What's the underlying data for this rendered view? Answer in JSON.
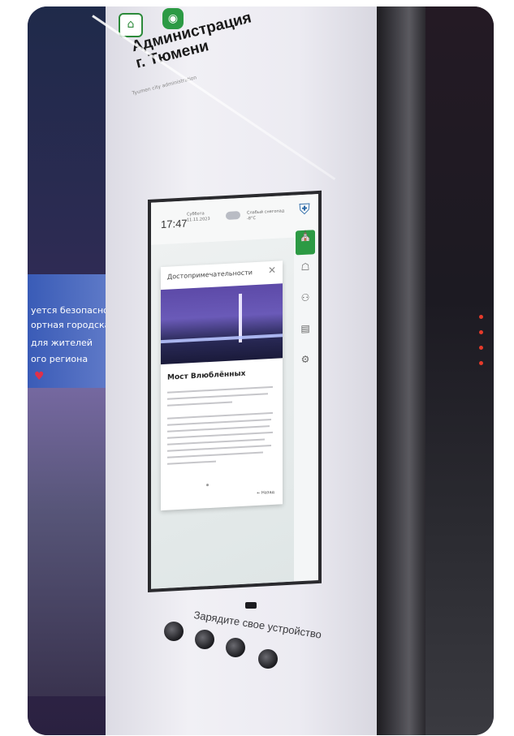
{
  "kiosk_header": {
    "title_line1": "Администрация",
    "title_line2": "г. Тюмени",
    "subtitle": "Tyumen city administration"
  },
  "screen": {
    "time": "17:47",
    "day": "Суббота",
    "date": "11.11.2023",
    "weather": "Слабый снегопад",
    "temperature": "-8°C",
    "card": {
      "header": "Достопримечательности",
      "title": "Мост Влюблённых",
      "back_label": "← Назад"
    }
  },
  "led_screen": {
    "lines": [
      "уется безопасность",
      "ортная городская",
      "для жителей",
      "ого региона"
    ]
  },
  "charging": {
    "label": "Зарядите свое устройство"
  },
  "icons": {
    "close": "close-icon",
    "coat_of_arms": "coat-of-arms-icon",
    "weather": "cloud-snow-icon"
  },
  "colors": {
    "accent_green": "#2c9a44",
    "led_blue": "#3b64c8"
  }
}
